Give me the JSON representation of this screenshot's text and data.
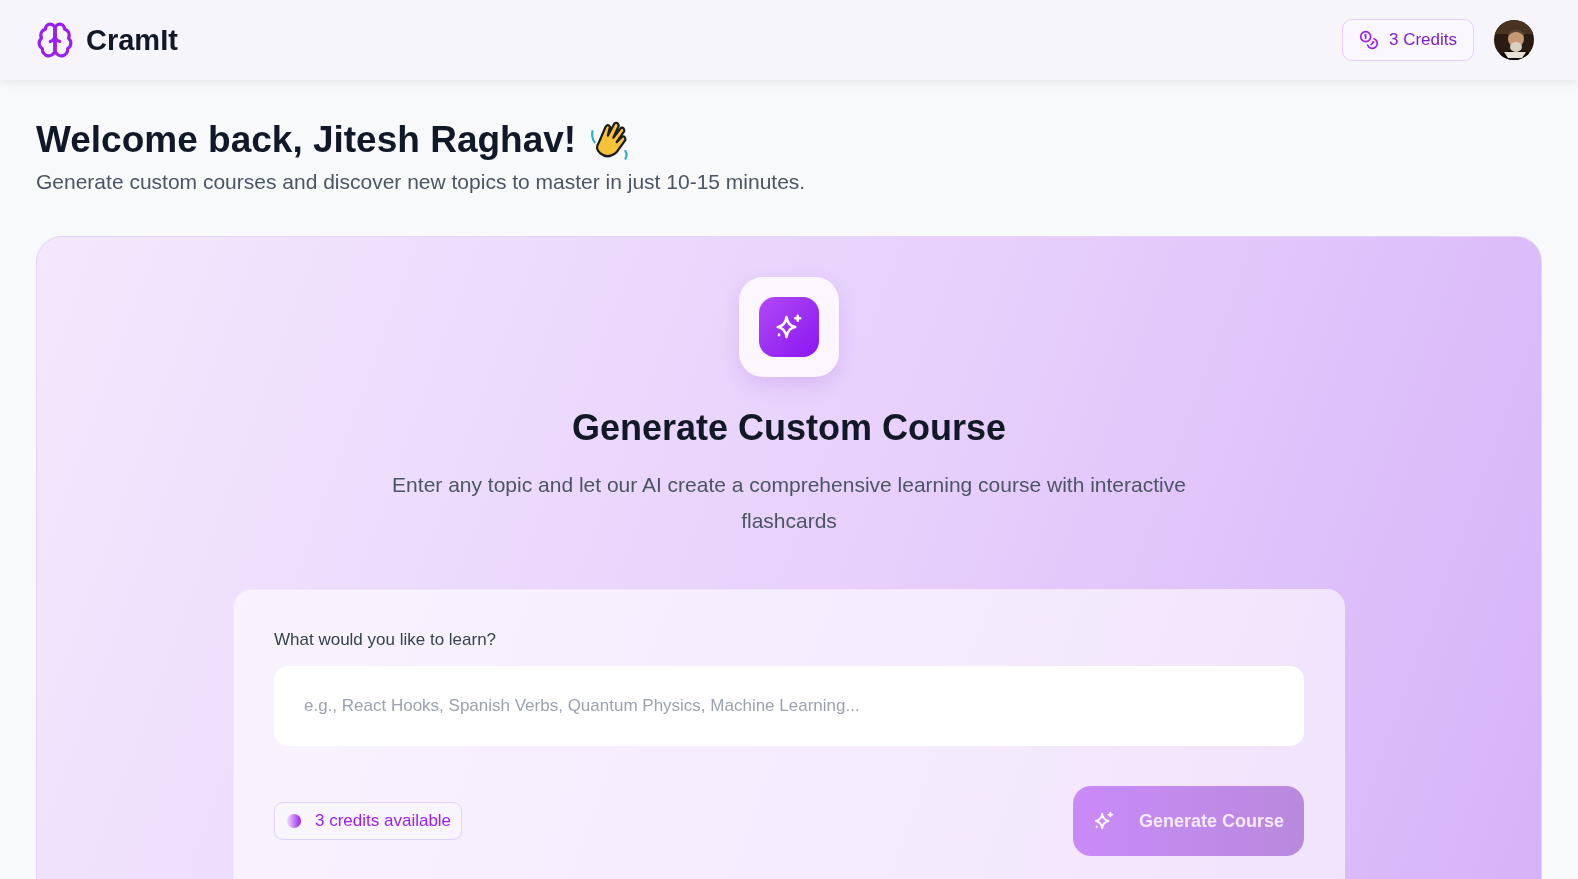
{
  "header": {
    "brand": "CramIt",
    "credits": "3 Credits"
  },
  "welcome": {
    "title": "Welcome back, Jitesh Raghav!",
    "subtitle": "Generate custom courses and discover new topics to master in just 10-15 minutes."
  },
  "generator": {
    "title": "Generate Custom Course",
    "description": "Enter any topic and let our AI create a comprehensive learning course with interactive flashcards",
    "field_label": "What would you like to learn?",
    "placeholder": "e.g., React Hooks, Spanish Verbs, Quantum Physics, Machine Learning...",
    "credits_available": "3 credits available",
    "button": {
      "label": "Generate Course",
      "disabled": true
    }
  }
}
